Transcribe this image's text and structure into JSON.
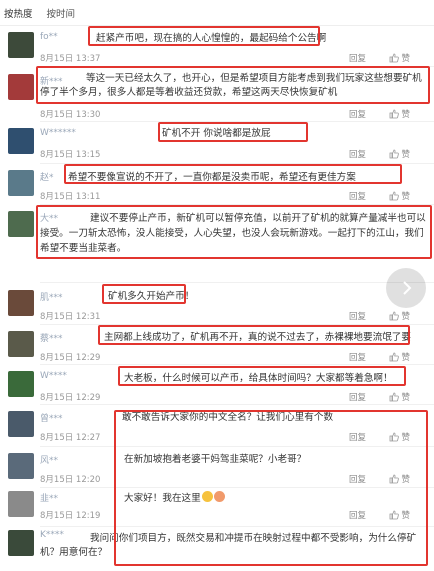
{
  "sort_tabs": [
    "按热度",
    "按时间"
  ],
  "reply_label": "回复",
  "like_label": "赞",
  "comments": [
    {
      "name": "fo**",
      "text": "赶紧产币吧，现在搞的人心惶惶的，最起码给个公告啊",
      "time": "8月15日 13:37",
      "avatar_color": "#3d4a3a"
    },
    {
      "name": "新***",
      "text": "等这一天已经太久了，也开心，但是希望项目方能考虑到我们玩家这些想要矿机停了半个多月，很多人都是等着收益还贷款，希望这两天尽快恢复矿机",
      "time": "8月15日 13:30",
      "avatar_color": "#a33a3a"
    },
    {
      "name": "W******",
      "text": "矿机不开 你说啥都是放屁",
      "time": "8月15日 13:15",
      "avatar_color": "#2f4f6f"
    },
    {
      "name": "赵*",
      "text": "希望不要像宣说的不开了，一直你都是没卖币呢，希望还有更佳方案",
      "time": "8月15日 13:11",
      "avatar_color": "#5a7a8a"
    },
    {
      "name": "大**",
      "text": "建议不要停止产币，新矿机可以暂停充值，以前开了矿机的就算产量减半也可以接受。一刀斩太恐怖，没人能接受，人心失望，也没人会玩新游戏。一起打下的江山，我们希望不要当韭菜者。",
      "time": "8月15日 12:31",
      "avatar_color": "#4e6b4e"
    },
    {
      "name": "肌***",
      "text": "矿机多久开始产币！",
      "time": "8月15日 12:31",
      "avatar_color": "#6a4a3a"
    },
    {
      "name": "蔡***",
      "text": "主网都上线成功了，矿机再不开，真的说不过去了，赤裸裸地要流氓了要",
      "time": "8月15日 12:29",
      "avatar_color": "#5a5a4a"
    },
    {
      "name": "W****",
      "text": "大老板，什么时候可以产币，给具体时间吗？大家都等着急啊！",
      "time": "8月15日 12:29",
      "avatar_color": "#3a6a3a"
    },
    {
      "name": "曾***",
      "text": "敢不敢告诉大家你的中文全名？让我们心里有个数",
      "time": "8月15日 12:27",
      "avatar_color": "#4a5a6a"
    },
    {
      "name": "风**",
      "text": "在新加坡抱着老婆干妈驾韭菜呢？小老哥？",
      "time": "8月15日 12:20",
      "avatar_color": "#5a6a7a"
    },
    {
      "name": "韭**",
      "text": "大家好！我在这里",
      "time": "8月15日 12:19",
      "avatar_color": "#8a8a8a"
    },
    {
      "name": "K****",
      "text": "我问问你们项目方，既然交易和冲提币在映射过程中都不受影响，为什么停矿机？用意何在？",
      "time": "8月15日 12:11",
      "avatar_color": "#3a4a3a"
    }
  ],
  "highlight_color": "#e2352f"
}
